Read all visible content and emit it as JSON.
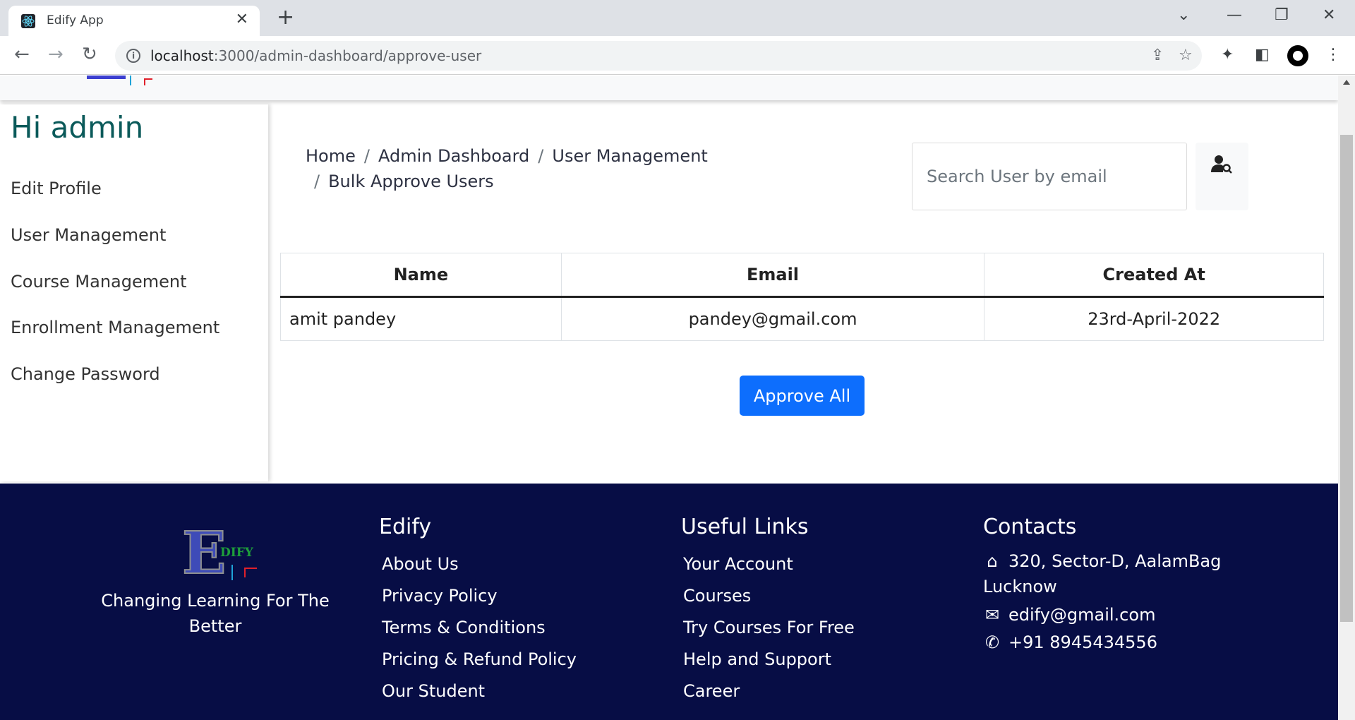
{
  "browser": {
    "tab_title": "Edify App",
    "url_host": "localhost",
    "url_path": ":3000/admin-dashboard/approve-user"
  },
  "sidebar": {
    "greeting": "Hi admin",
    "items": [
      {
        "label": "Edit Profile"
      },
      {
        "label": "User Management"
      },
      {
        "label": "Course Management"
      },
      {
        "label": "Enrollment Management"
      },
      {
        "label": "Change Password"
      }
    ]
  },
  "breadcrumb": {
    "items": [
      "Home",
      "Admin Dashboard",
      "User Management",
      "Bulk Approve Users"
    ]
  },
  "search": {
    "placeholder": "Search User by email"
  },
  "table": {
    "headers": [
      "Name",
      "Email",
      "Created At"
    ],
    "rows": [
      {
        "name": "amit pandey",
        "email": "pandey@gmail.com",
        "created_at": "23rd-April-2022"
      }
    ]
  },
  "approve_button": "Approve All",
  "footer": {
    "logo_text": "DIFY",
    "tagline": "Changing Learning For The Better",
    "edify": {
      "title": "Edify",
      "links": [
        "About Us",
        "Privacy Policy",
        "Terms & Conditions",
        "Pricing & Refund Policy",
        "Our Student"
      ]
    },
    "useful": {
      "title": "Useful Links",
      "links": [
        "Your Account",
        "Courses",
        "Try Courses For Free",
        "Help and Support",
        "Career"
      ]
    },
    "contacts": {
      "title": "Contacts",
      "address": "320, Sector-D, AalamBag Lucknow",
      "email": "edify@gmail.com",
      "phone": "+91 8945434556"
    }
  },
  "colors": {
    "primary_button": "#0d6efd",
    "footer_bg": "#070d45",
    "greeting": "#0b5a5a"
  }
}
